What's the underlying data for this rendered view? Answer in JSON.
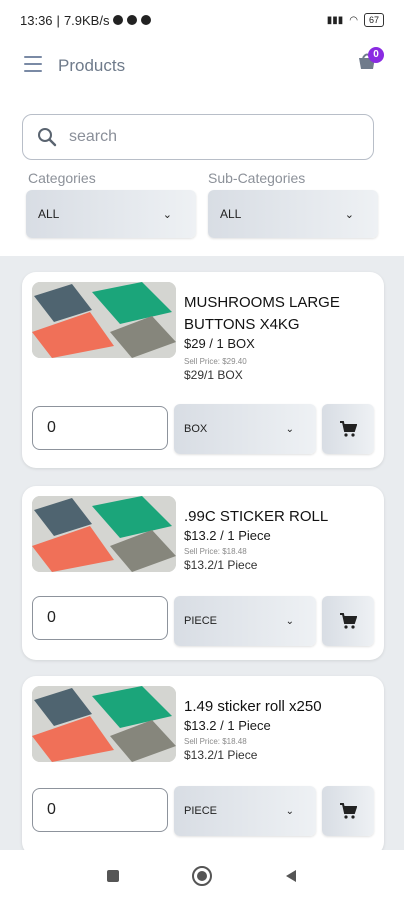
{
  "status": {
    "time": "13:36",
    "network": "7.9KB/s",
    "battery": "67"
  },
  "header": {
    "title": "Products",
    "cart_count": "0"
  },
  "search": {
    "placeholder": "search"
  },
  "filters": {
    "categories_label": "Categories",
    "categories_value": "ALL",
    "subcategories_label": "Sub-Categories",
    "subcategories_value": "ALL"
  },
  "products": [
    {
      "name": "MUSHROOMS LARGE BUTTONS X4KG",
      "price": "$29 / 1 BOX",
      "sell_price": "Sell Price: $29.40",
      "unit_price": "$29/1 BOX",
      "qty": "0",
      "unit": "BOX"
    },
    {
      "name": ".99C STICKER ROLL",
      "price": "$13.2 / 1 Piece",
      "sell_price": "Sell Price: $18.48",
      "unit_price": "$13.2/1 Piece",
      "qty": "0",
      "unit": "PIECE"
    },
    {
      "name": "1.49 sticker roll x250",
      "price": "$13.2 / 1 Piece",
      "sell_price": "Sell Price: $18.48",
      "unit_price": "$13.2/1 Piece",
      "qty": "0",
      "unit": "PIECE"
    }
  ],
  "colors": {
    "badge": "#8a2be2",
    "list_bg": "#e9ecef",
    "accent_text": "#6f7b8b"
  }
}
